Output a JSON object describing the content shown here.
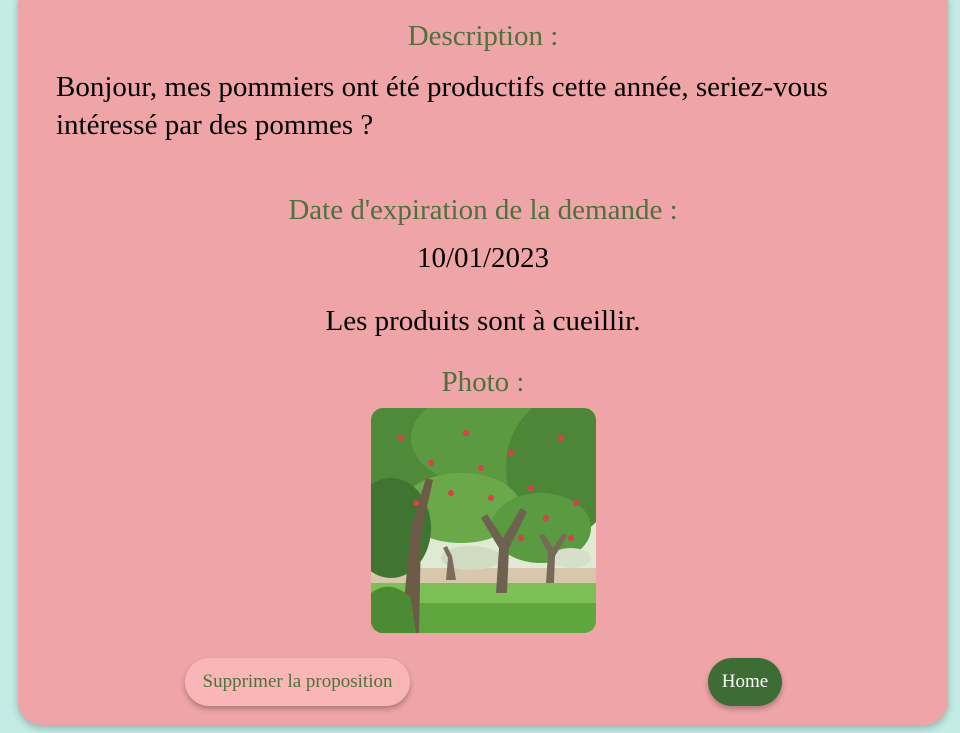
{
  "description": {
    "heading": "Description :",
    "text": "Bonjour, mes pommiers ont été productifs cette année, seriez-vous intéressé par des pommes ?"
  },
  "expiration": {
    "heading": "Date d'expiration de la demande :",
    "date": "10/01/2023"
  },
  "harvest_note": "Les produits sont à cueillir.",
  "photo": {
    "heading": "Photo :",
    "subject": "apple-orchard-photo"
  },
  "actions": {
    "delete_label": "Supprimer la proposition",
    "home_label": "Home"
  },
  "colors": {
    "background": "#c4ece6",
    "card": "#efa5a7",
    "heading_green": "#4f7140",
    "delete_button": "#fab5b6",
    "home_button": "#3d6c34"
  }
}
